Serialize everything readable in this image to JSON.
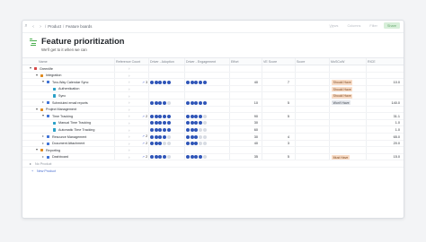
{
  "topbar": {
    "breadcrumb": [
      "Product",
      "Feature boards"
    ],
    "separator": "/",
    "actions": [
      "Views",
      "Columns",
      "Filter",
      "Share"
    ]
  },
  "header": {
    "title": "Feature prioritization",
    "subtitle": "We’ll get to it when we can"
  },
  "columns": [
    "Name",
    "Reference Count",
    "Driver - Adoption",
    "Driver - Engagement",
    "Effort",
    "VE Score",
    "Score",
    "MoSCoW",
    "RICE"
  ],
  "colors": {
    "dot_filled": "#2f55b8",
    "dot_empty": "#d8dce3",
    "should_have_bg": "#f9dcc6",
    "should_have_fg": "#7a4a24",
    "wont_have_bg": "#e4e7ec",
    "wont_have_fg": "#3e444d",
    "must_have_bg": "#f9dcc6",
    "must_have_fg": "#7a4a24",
    "product_sq": "#d64545",
    "component_sq": "#e08a1e",
    "feature_sq": "#3f73d6",
    "subfeature_sq": "#2aa0c7"
  },
  "rows": [
    {
      "level": 0,
      "kind": "product",
      "expanded": true,
      "name": "Greenlife"
    },
    {
      "level": 1,
      "kind": "component",
      "expanded": true,
      "name": "Integration"
    },
    {
      "level": 2,
      "kind": "feature",
      "expanded": true,
      "name": "Two-Way Calendar Sync",
      "refs": "3",
      "adoption": 5,
      "engagement": 5,
      "effort": "40",
      "ve": "7",
      "score": "",
      "moscow": "Should Have",
      "rice": "10.0"
    },
    {
      "level": 3,
      "kind": "subfeature",
      "name": "Authentication",
      "refs": "",
      "adoption": 0,
      "engagement": 0,
      "effort": "",
      "ve": "",
      "score": "",
      "moscow": "Should Have",
      "rice": ""
    },
    {
      "level": 3,
      "kind": "subfeature",
      "name": "Sync",
      "refs": "",
      "adoption": 0,
      "engagement": 0,
      "effort": "",
      "ve": "",
      "score": "",
      "moscow": "Should Have",
      "rice": ""
    },
    {
      "level": 2,
      "kind": "feature",
      "name": "Scheduled email reports",
      "refs": "",
      "adoption": 4,
      "engagement": 5,
      "effort": "10",
      "ve": "5",
      "score": "",
      "moscow": "Won't Have",
      "rice": "140.0"
    },
    {
      "level": 1,
      "kind": "component",
      "expanded": true,
      "name": "Project Management"
    },
    {
      "level": 2,
      "kind": "feature",
      "expanded": true,
      "name": "Time Tracking",
      "refs": "2",
      "adoption": 5,
      "engagement": 4,
      "effort": "90",
      "ve": "5",
      "score": "",
      "moscow": "",
      "rice": "31.1"
    },
    {
      "level": 3,
      "kind": "subfeature",
      "name": "Manual Time Tracking",
      "refs": "",
      "adoption": 5,
      "engagement": 4,
      "effort": "30",
      "ve": "",
      "score": "",
      "moscow": "",
      "rice": "1.0"
    },
    {
      "level": 3,
      "kind": "subfeature",
      "name": "Automatic Time Tracking",
      "refs": "",
      "adoption": 5,
      "engagement": 3,
      "effort": "60",
      "ve": "",
      "score": "",
      "moscow": "",
      "rice": "1.0"
    },
    {
      "level": 2,
      "kind": "feature",
      "name": "Resource Management",
      "refs": "2",
      "adoption": 4,
      "engagement": 3,
      "effort": "30",
      "ve": "4",
      "score": "",
      "moscow": "",
      "rice": "65.0"
    },
    {
      "level": 2,
      "kind": "feature",
      "name": "Document Attachment",
      "refs": "2",
      "adoption": 3,
      "engagement": 3,
      "effort": "40",
      "ve": "3",
      "score": "",
      "moscow": "",
      "rice": "20.0"
    },
    {
      "level": 1,
      "kind": "component",
      "expanded": true,
      "name": "Reporting"
    },
    {
      "level": 2,
      "kind": "feature",
      "name": "Dashboard",
      "refs": "2",
      "adoption": 4,
      "engagement": 4,
      "effort": "35",
      "ve": "5",
      "score": "",
      "moscow": "Must Have",
      "rice": "15.0"
    },
    {
      "level": 0,
      "kind": "noproduct",
      "expanded": false,
      "name": "No Product"
    },
    {
      "level": 0,
      "kind": "new",
      "name": "New Product"
    }
  ]
}
